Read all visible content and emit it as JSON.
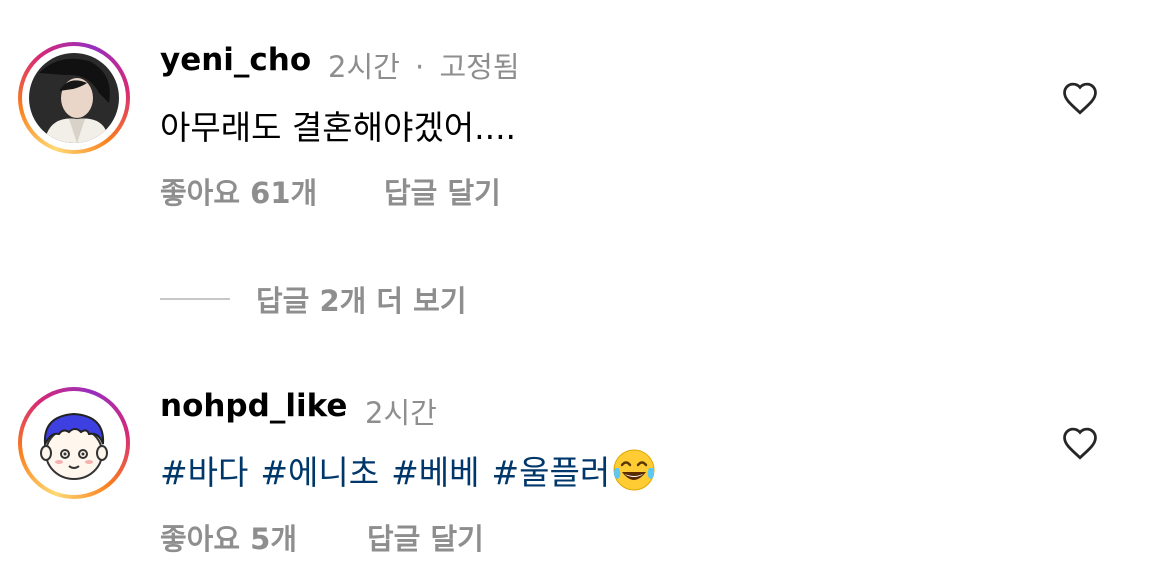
{
  "comments": [
    {
      "username": "yeni_cho",
      "time": "2시간",
      "separator": "·",
      "pinned": "고정됨",
      "text": "아무래도 결혼해야겠어....",
      "likes": "좋아요 61개",
      "reply": "답글 달기"
    },
    {
      "username": "nohpd_like",
      "time": "2시간",
      "tags": [
        "#바다",
        "#에니초",
        "#베베",
        "#울플러"
      ],
      "emoji_icon": "face-with-tears-of-joy",
      "likes": "좋아요 5개",
      "reply": "답글 달기"
    }
  ],
  "view_replies": "답글 2개 더 보기",
  "colors": {
    "meta_gray": "#8e8e8e",
    "hashtag_blue": "#00376b",
    "divider": "#c7c7c7"
  }
}
